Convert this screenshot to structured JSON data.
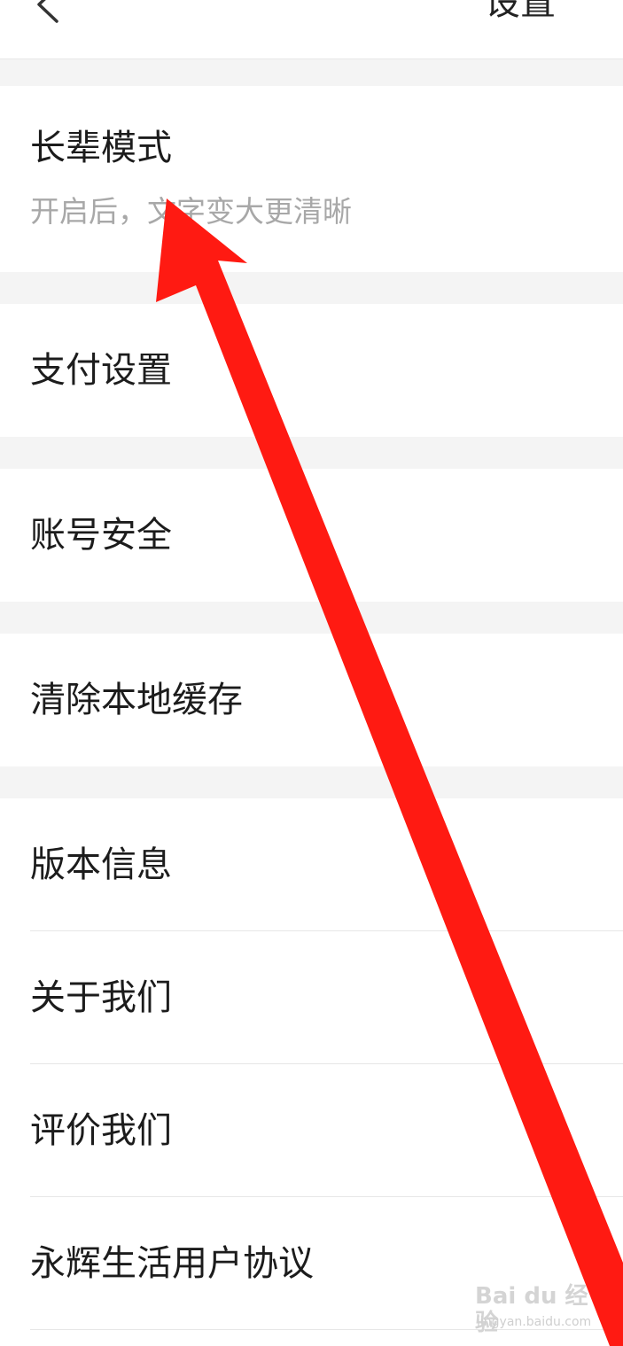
{
  "header": {
    "title": "设置",
    "back_icon": "chevron-left-icon"
  },
  "settings": {
    "elder_mode": {
      "label": "长辈模式",
      "subtitle": "开启后，文字变大更清晰"
    },
    "payment": {
      "label": "支付设置"
    },
    "account_security": {
      "label": "账号安全"
    },
    "clear_cache": {
      "label": "清除本地缓存"
    },
    "version_info": {
      "label": "版本信息"
    },
    "about_us": {
      "label": "关于我们"
    },
    "rate_us": {
      "label": "评价我们"
    },
    "user_agreement": {
      "label": "永辉生活用户协议"
    }
  },
  "annotation": {
    "arrow_color": "#ff1a12"
  },
  "watermark": {
    "main": "Bai du 经验",
    "sub": "jingyan.baidu.com"
  },
  "colors": {
    "background": "#ffffff",
    "section_gap": "#f4f4f4",
    "subtitle_text": "#a8a8a8"
  }
}
